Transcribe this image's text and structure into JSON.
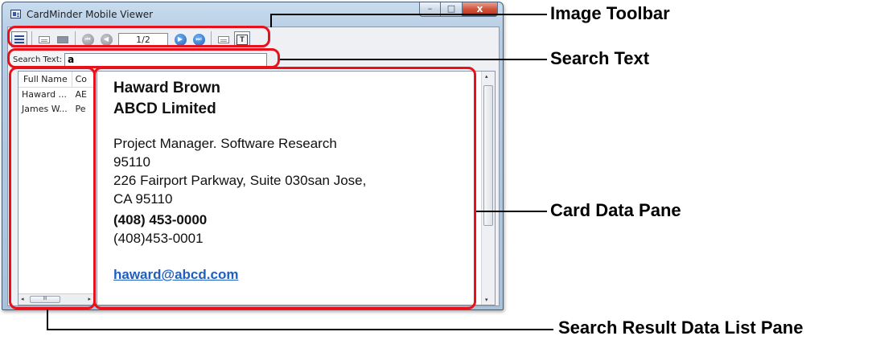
{
  "window": {
    "title": "CardMinder Mobile Viewer",
    "controls": {
      "minimize": "–",
      "maximize": "□",
      "close": "x"
    }
  },
  "toolbar": {
    "page_indicator": "1/2",
    "icons": [
      "list-view-icon",
      "card-front-icon",
      "card-back-icon",
      "first-page-icon",
      "previous-page-icon",
      "next-page-icon",
      "last-page-icon",
      "image-card-icon",
      "text-view-icon"
    ],
    "text_view_glyph": "T",
    "nav_glyphs": {
      "first": "⏮",
      "prev": "◀",
      "next": "▶",
      "last": "⏭"
    }
  },
  "search": {
    "label": "Search Text:",
    "value": "a"
  },
  "result_list": {
    "columns": [
      "Full Name",
      "Co"
    ],
    "rows": [
      [
        "Haward ...",
        "AE"
      ],
      [
        "James W...",
        "Pe"
      ]
    ],
    "scroll_left": "◂",
    "scroll_right": "▸",
    "thumb_grip": "III"
  },
  "card": {
    "name": "Haward Brown",
    "company": "ABCD Limited",
    "title_dept": "Project Manager. Software Research",
    "zip": "95110",
    "address1": "226 Fairport Parkway, Suite 030san Jose,",
    "address2": "CA 95110",
    "phone_bold": "(408) 453-0000",
    "phone2": "(408)453-0001",
    "email": "haward@abcd.com",
    "scroll_up": "▴",
    "scroll_down": "▾"
  },
  "annotations": {
    "image_toolbar": "Image Toolbar",
    "search_text": "Search Text",
    "card_data_pane": "Card Data Pane",
    "search_result_list": "Search Result Data List Pane"
  },
  "colors": {
    "callout": "#e8101a",
    "email_link": "#1f5fbf",
    "nav_active": "#1d62c4",
    "nav_inactive": "#8a8d93"
  }
}
